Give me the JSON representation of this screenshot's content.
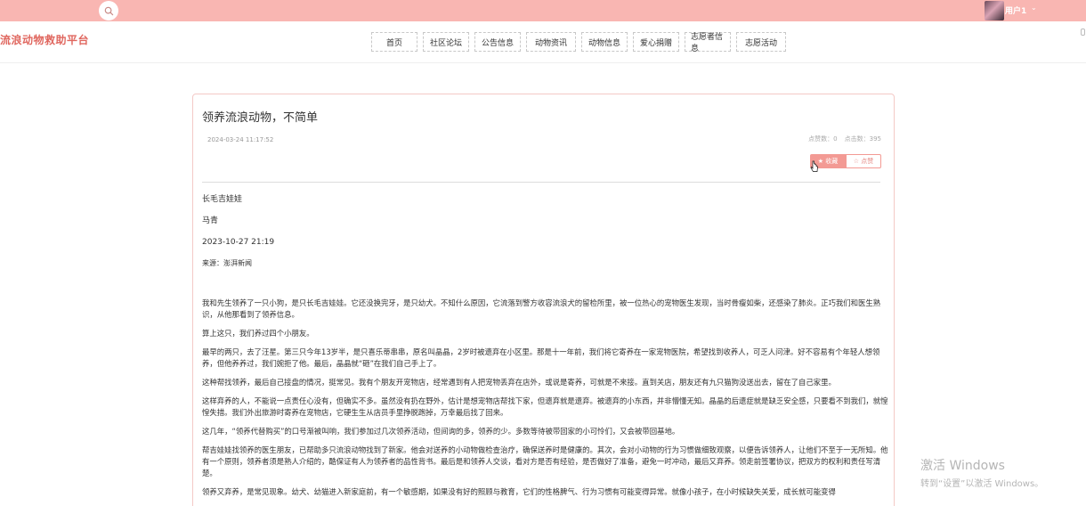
{
  "topbar": {
    "search_icon": "search-icon",
    "username": "用户1",
    "caret": "⌄",
    "color": "#f9b6b2"
  },
  "header": {
    "brand": "流浪动物救助平台",
    "nav": [
      "首页",
      "社区论坛",
      "公告信息",
      "动物资讯",
      "动物信息",
      "爱心捐赠",
      "志愿者信息",
      "志愿活动"
    ]
  },
  "article": {
    "title": "领养流浪动物，不简单",
    "date": "2024-03-24 11:17:52",
    "clicks": "点赞数：0",
    "favorites": "点击数：395",
    "fav_label": "★ 收藏",
    "like_label": "☆ 点赞",
    "meta": [
      "长毛吉娃娃",
      "马青",
      "2023-10-27 21:19",
      "来源：澎湃新闻"
    ],
    "paragraphs": [
      "我和先生领养了一只小狗，是只长毛吉娃娃。它还没换完牙，是只幼犬。不知什么原因，它流落到警方收容流浪犬的留检所里，被一位热心的宠物医生发现，当时骨瘦如柴，还感染了肺炎。正巧我们和医生熟识，从他那看到了领养信息。",
      "算上这只，我们养过四个小朋友。",
      "最早的两只，去了汪星。第三只今年13岁半，是只喜乐蒂串串，原名叫晶晶，2岁时被遗弃在小区里。那是十一年前，我们将它寄养在一家宠物医院，希望找到收养人，可乏人问津。好不容易有个年轻人想领养，但他养养过，我们婉拒了他。最后，晶晶就“砸”在我们自己手上了。",
      "这种帮找领养，最后自己接盘的情况，挺常见。我有个朋友开宠物店，经常遇到有人把宠物丢弃在店外，或说是寄养，可就是不来接。直到关店，朋友还有九只猫狗没送出去，留在了自己家里。",
      "这样弃养的人，不能说一点责任心没有，但确实不多。虽然没有扔在野外，估计是想宠物店帮找下家，但遗弃就是遗弃。被遗弃的小东西，并非懵懂无知。晶晶的后遗症就是缺乏安全感，只要看不到我们，就惶惶失措。我们外出旅游时寄养在宠物店，它硬生生从店员手里挣脱跑掉，万幸最后找了回来。",
      "这几年，“领养代替购买”的口号渐被叫响，我们参加过几次领养活动，但间询的多，领养的少。多数等待被带回家的小可怜们，又会被带回基地。",
      "帮吉娃娃找领养的医生朋友，已帮助多只流浪动物找到了新家。他会对送养的小动物做检查治疗，确保送养时是健康的。其次，会对小动物的行为习惯做细致观察，以便告诉领养人，让他们不至于一无所知。他有一个原则，领养者须是熟人介绍的，酷保证有人为领养者的品性背书。最后是和领养人交谈，看对方是否有经验，是否做好了准备，避免一时冲动，最后又弃养。领走前签署协议，把双方的权利和责任写清楚。",
      "领养又弃养，是常见现象。幼犬、幼猫进入新家庭前，有一个敏感期，如果没有好的照顾与教育，它们的性格脾气、行为习惯有可能变得异常。就像小孩子，在小时候缺失关爱，成长就可能变得"
    ]
  },
  "watermark": {
    "title": "激活 Windows",
    "subtitle": "转到“设置”以激活 Windows。"
  }
}
